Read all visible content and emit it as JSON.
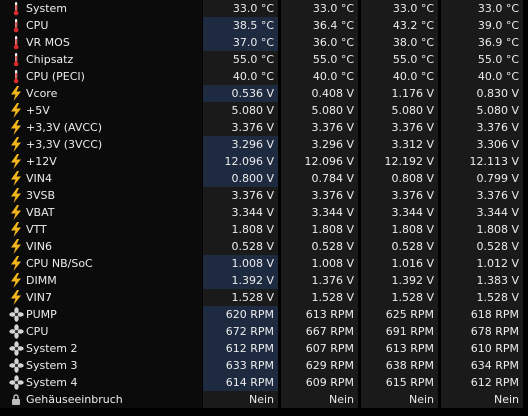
{
  "rows": [
    {
      "icon": "thermometer-icon",
      "label": "System",
      "values": [
        "33.0 °C",
        "33.0 °C",
        "33.0 °C",
        "33.0 °C"
      ],
      "highlight": false
    },
    {
      "icon": "thermometer-icon",
      "label": "CPU",
      "values": [
        "38.5 °C",
        "36.4 °C",
        "43.2 °C",
        "39.0 °C"
      ],
      "highlight": true
    },
    {
      "icon": "thermometer-icon",
      "label": "VR MOS",
      "values": [
        "37.0 °C",
        "36.0 °C",
        "38.0 °C",
        "36.9 °C"
      ],
      "highlight": true
    },
    {
      "icon": "thermometer-icon",
      "label": "Chipsatz",
      "values": [
        "55.0 °C",
        "55.0 °C",
        "55.0 °C",
        "55.0 °C"
      ],
      "highlight": false
    },
    {
      "icon": "thermometer-icon",
      "label": "CPU (PECI)",
      "values": [
        "40.0 °C",
        "40.0 °C",
        "40.0 °C",
        "40.0 °C"
      ],
      "highlight": false
    },
    {
      "icon": "lightning-bolt-icon",
      "label": "Vcore",
      "values": [
        "0.536 V",
        "0.408 V",
        "1.176 V",
        "0.830 V"
      ],
      "highlight": true
    },
    {
      "icon": "lightning-bolt-icon",
      "label": "+5V",
      "values": [
        "5.080 V",
        "5.080 V",
        "5.080 V",
        "5.080 V"
      ],
      "highlight": false
    },
    {
      "icon": "lightning-bolt-icon",
      "label": "+3,3V (AVCC)",
      "values": [
        "3.376 V",
        "3.376 V",
        "3.376 V",
        "3.376 V"
      ],
      "highlight": false
    },
    {
      "icon": "lightning-bolt-icon",
      "label": "+3,3V (3VCC)",
      "values": [
        "3.296 V",
        "3.296 V",
        "3.312 V",
        "3.306 V"
      ],
      "highlight": true
    },
    {
      "icon": "lightning-bolt-icon",
      "label": "+12V",
      "values": [
        "12.096 V",
        "12.096 V",
        "12.192 V",
        "12.113 V"
      ],
      "highlight": true
    },
    {
      "icon": "lightning-bolt-icon",
      "label": "VIN4",
      "values": [
        "0.800 V",
        "0.784 V",
        "0.808 V",
        "0.799 V"
      ],
      "highlight": true
    },
    {
      "icon": "lightning-bolt-icon",
      "label": "3VSB",
      "values": [
        "3.376 V",
        "3.376 V",
        "3.376 V",
        "3.376 V"
      ],
      "highlight": false
    },
    {
      "icon": "lightning-bolt-icon",
      "label": "VBAT",
      "values": [
        "3.344 V",
        "3.344 V",
        "3.344 V",
        "3.344 V"
      ],
      "highlight": false
    },
    {
      "icon": "lightning-bolt-icon",
      "label": "VTT",
      "values": [
        "1.808 V",
        "1.808 V",
        "1.808 V",
        "1.808 V"
      ],
      "highlight": false
    },
    {
      "icon": "lightning-bolt-icon",
      "label": "VIN6",
      "values": [
        "0.528 V",
        "0.528 V",
        "0.528 V",
        "0.528 V"
      ],
      "highlight": false
    },
    {
      "icon": "lightning-bolt-icon",
      "label": "CPU NB/SoC",
      "values": [
        "1.008 V",
        "1.008 V",
        "1.016 V",
        "1.012 V"
      ],
      "highlight": true
    },
    {
      "icon": "lightning-bolt-icon",
      "label": "DIMM",
      "values": [
        "1.392 V",
        "1.376 V",
        "1.392 V",
        "1.383 V"
      ],
      "highlight": true
    },
    {
      "icon": "lightning-bolt-icon",
      "label": "VIN7",
      "values": [
        "1.528 V",
        "1.528 V",
        "1.528 V",
        "1.528 V"
      ],
      "highlight": false
    },
    {
      "icon": "fan-icon",
      "label": "PUMP",
      "values": [
        "620 RPM",
        "613 RPM",
        "625 RPM",
        "618 RPM"
      ],
      "highlight": true
    },
    {
      "icon": "fan-icon",
      "label": "CPU",
      "values": [
        "672 RPM",
        "667 RPM",
        "691 RPM",
        "678 RPM"
      ],
      "highlight": true
    },
    {
      "icon": "fan-icon",
      "label": "System 2",
      "values": [
        "612 RPM",
        "607 RPM",
        "613 RPM",
        "610 RPM"
      ],
      "highlight": true
    },
    {
      "icon": "fan-icon",
      "label": "System 3",
      "values": [
        "633 RPM",
        "629 RPM",
        "638 RPM",
        "634 RPM"
      ],
      "highlight": true
    },
    {
      "icon": "fan-icon",
      "label": "System 4",
      "values": [
        "614 RPM",
        "609 RPM",
        "615 RPM",
        "612 RPM"
      ],
      "highlight": true
    },
    {
      "icon": "lock-icon",
      "label": "Gehäuseeinbruch",
      "values": [
        "Nein",
        "Nein",
        "Nein",
        "Nein"
      ],
      "highlight": false
    }
  ],
  "colors": {
    "background": "#000000",
    "label_bg": "#0b0b0b",
    "value_bg": "#1a1a1a",
    "highlight_bg": "#1e2a40",
    "text": "#ececec",
    "thermometer_red": "#d92b2b",
    "bolt_yellow": "#f2b51c",
    "fan_gray": "#d4d4d4"
  }
}
